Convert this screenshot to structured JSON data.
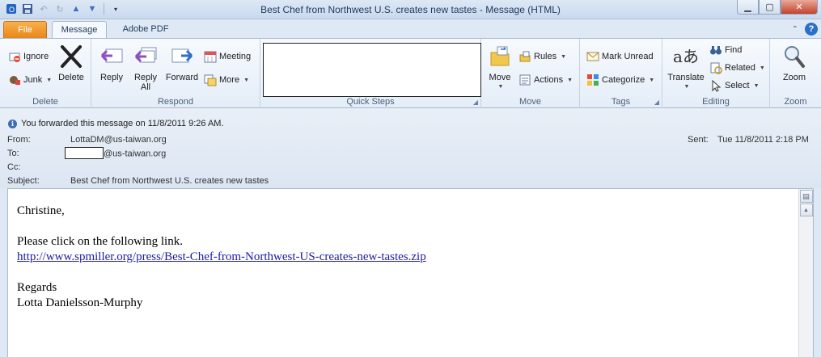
{
  "window": {
    "title": "Best Chef from Northwest U.S. creates new tastes  -  Message (HTML)"
  },
  "tabs": [
    {
      "label": "File"
    },
    {
      "label": "Message"
    },
    {
      "label": "Adobe PDF"
    }
  ],
  "ribbon": {
    "delete": {
      "group_label": "Delete",
      "ignore": "Ignore",
      "junk": "Junk",
      "delete": "Delete"
    },
    "respond": {
      "group_label": "Respond",
      "reply": "Reply",
      "reply_all_line1": "Reply",
      "reply_all_line2": "All",
      "forward": "Forward",
      "meeting": "Meeting",
      "more": "More"
    },
    "quick_steps": {
      "group_label": "Quick Steps"
    },
    "move": {
      "group_label": "Move",
      "move": "Move",
      "rules": "Rules",
      "actions": "Actions"
    },
    "tags": {
      "group_label": "Tags",
      "mark_unread": "Mark Unread",
      "categorize": "Categorize"
    },
    "editing": {
      "group_label": "Editing",
      "translate": "Translate",
      "find": "Find",
      "related": "Related",
      "select": "Select"
    },
    "zoom": {
      "group_label": "Zoom",
      "zoom": "Zoom"
    }
  },
  "info": {
    "forward_note": "You forwarded this message on 11/8/2011 9:26 AM."
  },
  "header": {
    "from_label": "From:",
    "from_value": "LottaDM@us-taiwan.org",
    "to_label": "To:",
    "to_value": "@us-taiwan.org",
    "cc_label": "Cc:",
    "subject_label": "Subject:",
    "subject_value": "Best Chef from Northwest U.S. creates new tastes",
    "sent_label": "Sent:",
    "sent_value": "Tue 11/8/2011 2:18 PM"
  },
  "body": {
    "greeting": "Christine,",
    "line1": "Please click on the following link.",
    "link": "http://www.spmiller.org/press/Best-Chef-from-Northwest-US-creates-new-tastes.zip",
    "closing": "Regards",
    "signature": "Lotta Danielsson-Murphy"
  },
  "colors": {
    "file_tab": "#e8861a",
    "link": "#1a1aa6",
    "ribbon_bg": "#e4edf8"
  }
}
